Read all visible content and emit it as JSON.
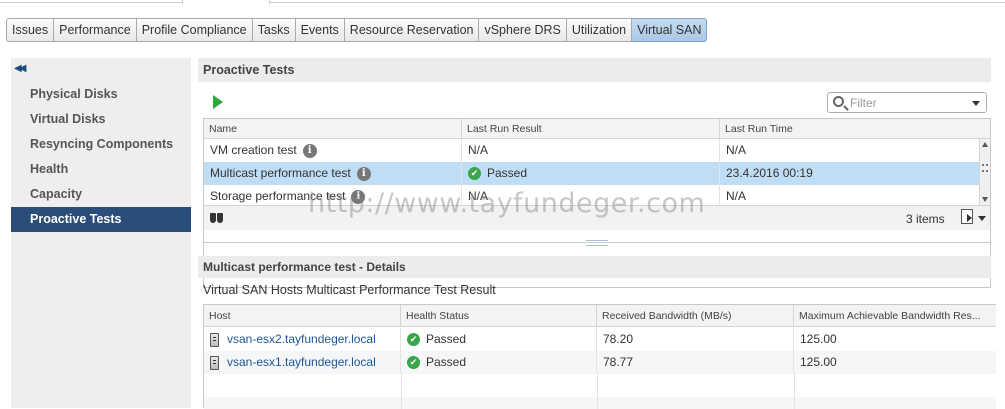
{
  "subtabs": [
    "Issues",
    "Performance",
    "Profile Compliance",
    "Tasks",
    "Events",
    "Resource Reservation",
    "vSphere DRS",
    "Utilization",
    "Virtual SAN"
  ],
  "leftnav": {
    "items": [
      "Physical Disks",
      "Virtual Disks",
      "Resyncing Components",
      "Health",
      "Capacity",
      "Proactive Tests"
    ]
  },
  "proactive": {
    "title": "Proactive Tests",
    "filter_placeholder": "Filter",
    "columns": [
      "Name",
      "Last Run Result",
      "Last Run Time"
    ],
    "rows": [
      {
        "name": "VM creation test",
        "result": "N/A",
        "time": "N/A"
      },
      {
        "name": "Multicast performance test",
        "result": "Passed",
        "time": "23.4.2016 00:19"
      },
      {
        "name": "Storage performance test",
        "result": "N/A",
        "time": "N/A"
      }
    ],
    "items_count": "3 items"
  },
  "details": {
    "title": "Multicast performance test - Details",
    "subtitle": "Virtual SAN Hosts Multicast Performance Test Result",
    "columns": [
      "Host",
      "Health Status",
      "Received Bandwidth (MB/s)",
      "Maximum Achievable Bandwidth Res..."
    ],
    "rows": [
      {
        "host": "vsan-esx2.tayfundeger.local",
        "status": "Passed",
        "received": "78.20",
        "max": "125.00"
      },
      {
        "host": "vsan-esx1.tayfundeger.local",
        "status": "Passed",
        "received": "78.77",
        "max": "125.00"
      }
    ]
  },
  "watermark": "http://www.tayfundeger.com",
  "colors": {
    "selected_row": "#c0ddf6",
    "nav_active": "#2a4d7a",
    "passed": "#3aa54a",
    "run": "#2fa83a",
    "link": "#1f5796"
  }
}
